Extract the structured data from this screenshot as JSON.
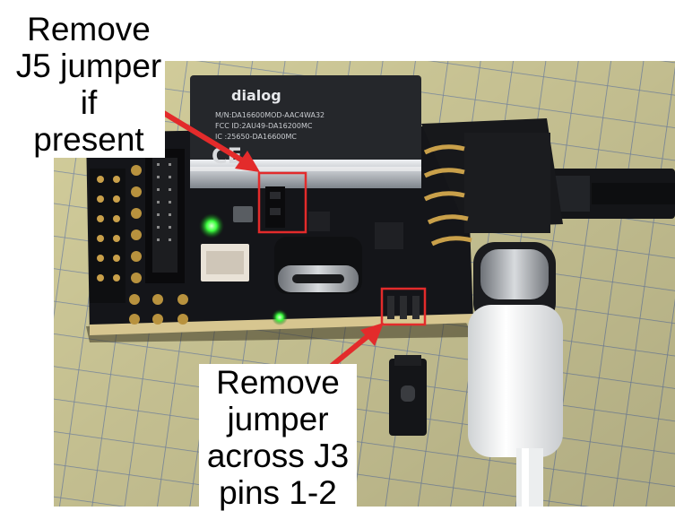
{
  "annotations": {
    "top": {
      "text": "Remove\nJ5 jumper if\npresent",
      "points_to": "J5 jumper"
    },
    "bottom": {
      "text": "Remove\njumper\nacross J3\npins 1-2",
      "points_to": "J3 pins 1-2"
    },
    "highlight_color": "#e32b2b"
  },
  "module": {
    "brand": "dialog",
    "marking_lines": [
      "M/N:DA16600MOD-AAC4WA32",
      "FCC ID:2AU49-DA16200MC",
      "IC :25650-DA16600MC"
    ],
    "ce_mark": "CE"
  },
  "colors": {
    "grid_paper": "#e9e3a8",
    "grid_lines": "#8fa0b8",
    "pcb": "#131417",
    "gold": "#c9a04a",
    "led_green": "#37ff3a"
  }
}
